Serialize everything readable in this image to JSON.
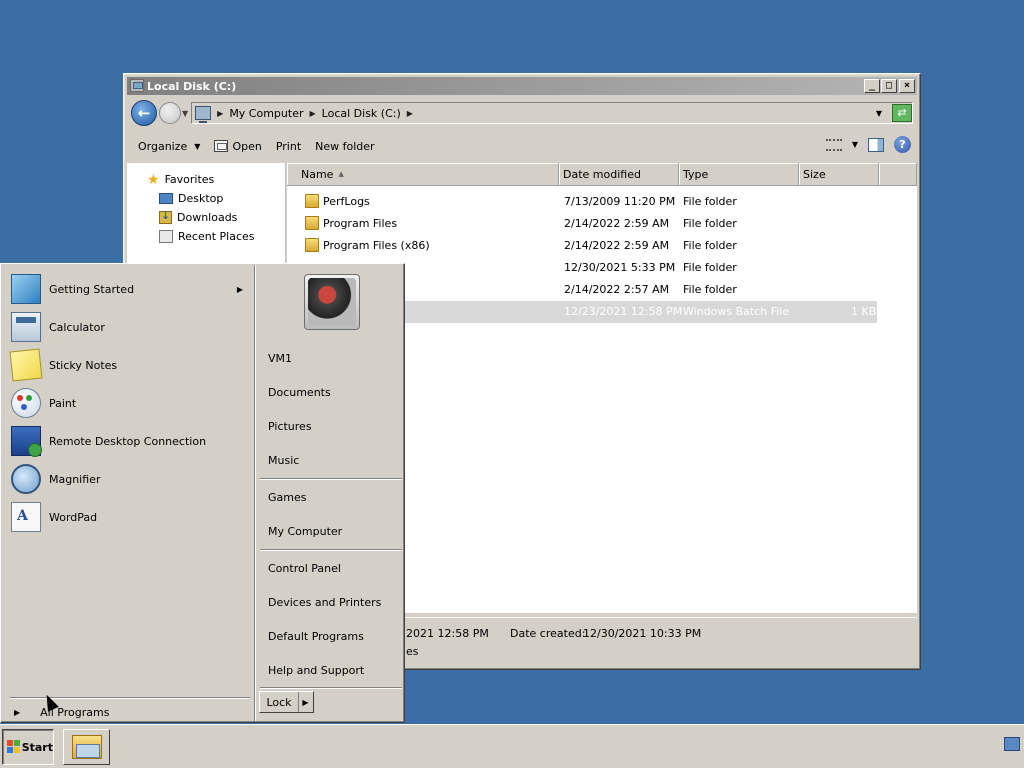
{
  "window": {
    "title": "Local Disk (C:)",
    "address": {
      "crumbs": [
        "My Computer",
        "Local Disk (C:)"
      ]
    },
    "commands": {
      "organize": "Organize",
      "open": "Open",
      "print": "Print",
      "new_folder": "New folder"
    },
    "nav": {
      "favorites": "Favorites",
      "items": [
        "Desktop",
        "Downloads",
        "Recent Places"
      ]
    },
    "columns": {
      "name": "Name",
      "date": "Date modified",
      "type": "Type",
      "size": "Size"
    },
    "rows": [
      {
        "name": "PerfLogs",
        "date": "7/13/2009 11:20 PM",
        "type": "File folder",
        "size": ""
      },
      {
        "name": "Program Files",
        "date": "2/14/2022 2:59 AM",
        "type": "File folder",
        "size": ""
      },
      {
        "name": "Program Files (x86)",
        "date": "2/14/2022 2:59 AM",
        "type": "File folder",
        "size": ""
      },
      {
        "name": "",
        "date": "12/30/2021 5:33 PM",
        "type": "File folder",
        "size": ""
      },
      {
        "name": "",
        "date": "2/14/2022 2:57 AM",
        "type": "File folder",
        "size": ""
      },
      {
        "name": "",
        "date": "12/23/2021 12:58 PM",
        "type": "Windows Batch File",
        "size": "1 KB"
      }
    ],
    "details": {
      "modified_partial": "2021 12:58 PM",
      "created_label": "Date created:",
      "created_value": "12/30/2021 10:33 PM",
      "line2_partial": "es"
    }
  },
  "start_menu": {
    "programs": [
      {
        "label": "Getting Started",
        "icon": "getting-started-icon",
        "has_submenu": true
      },
      {
        "label": "Calculator",
        "icon": "calculator-icon"
      },
      {
        "label": "Sticky Notes",
        "icon": "sticky-notes-icon"
      },
      {
        "label": "Paint",
        "icon": "paint-icon"
      },
      {
        "label": "Remote Desktop Connection",
        "icon": "remote-desktop-icon"
      },
      {
        "label": "Magnifier",
        "icon": "magnifier-icon"
      },
      {
        "label": "WordPad",
        "icon": "wordpad-icon"
      }
    ],
    "all_programs": "All Programs",
    "right": {
      "user": "VM1",
      "links_a": [
        "Documents",
        "Pictures",
        "Music"
      ],
      "links_b": [
        "Games",
        "My Computer"
      ],
      "links_c": [
        "Control Panel",
        "Devices and Printers",
        "Default Programs",
        "Help and Support"
      ]
    },
    "lock": "Lock"
  },
  "taskbar": {
    "start": "Start"
  }
}
